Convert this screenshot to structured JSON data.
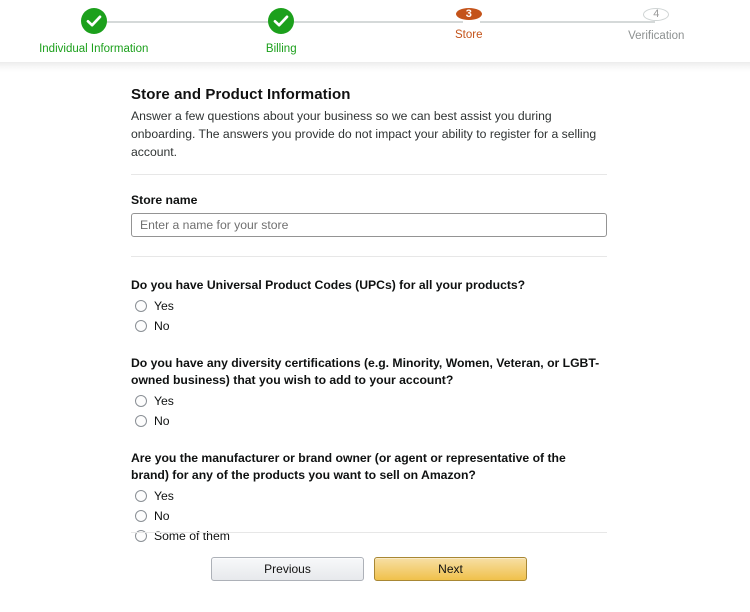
{
  "stepper": {
    "steps": [
      {
        "label": "Individual Information",
        "state": "done",
        "marker": "check-icon"
      },
      {
        "label": "Billing",
        "state": "done",
        "marker": "check-icon"
      },
      {
        "label": "Store",
        "state": "current",
        "marker": "3"
      },
      {
        "label": "Verification",
        "state": "pending",
        "marker": "4"
      }
    ],
    "colors": {
      "done": "#1ca01c",
      "current": "#c4531a",
      "pending": "#9a9a9a",
      "connector": "#d5d9d9"
    }
  },
  "main": {
    "title": "Store and Product Information",
    "description": "Answer a few questions about your business so we can best assist you during onboarding. The answers you provide do not impact your ability to register for a selling account.",
    "store_name": {
      "label": "Store name",
      "placeholder": "Enter a name for your store",
      "value": ""
    },
    "questions": [
      {
        "text": "Do you have Universal Product Codes (UPCs) for all your products?",
        "options": [
          {
            "label": "Yes",
            "selected": false
          },
          {
            "label": "No",
            "selected": false
          }
        ]
      },
      {
        "text": "Do you have any diversity certifications (e.g. Minority, Women, Veteran, or LGBT-owned business) that you wish to add to your account?",
        "options": [
          {
            "label": "Yes",
            "selected": false
          },
          {
            "label": "No",
            "selected": false
          }
        ]
      },
      {
        "text": "Are you the manufacturer or brand owner (or agent or representative of the brand) for any of the products you want to sell on Amazon?",
        "options": [
          {
            "label": "Yes",
            "selected": false
          },
          {
            "label": "No",
            "selected": false
          },
          {
            "label": "Some of them",
            "selected": false
          }
        ]
      }
    ]
  },
  "footer": {
    "previous_label": "Previous",
    "next_label": "Next",
    "next_color": "#f0c14b"
  }
}
